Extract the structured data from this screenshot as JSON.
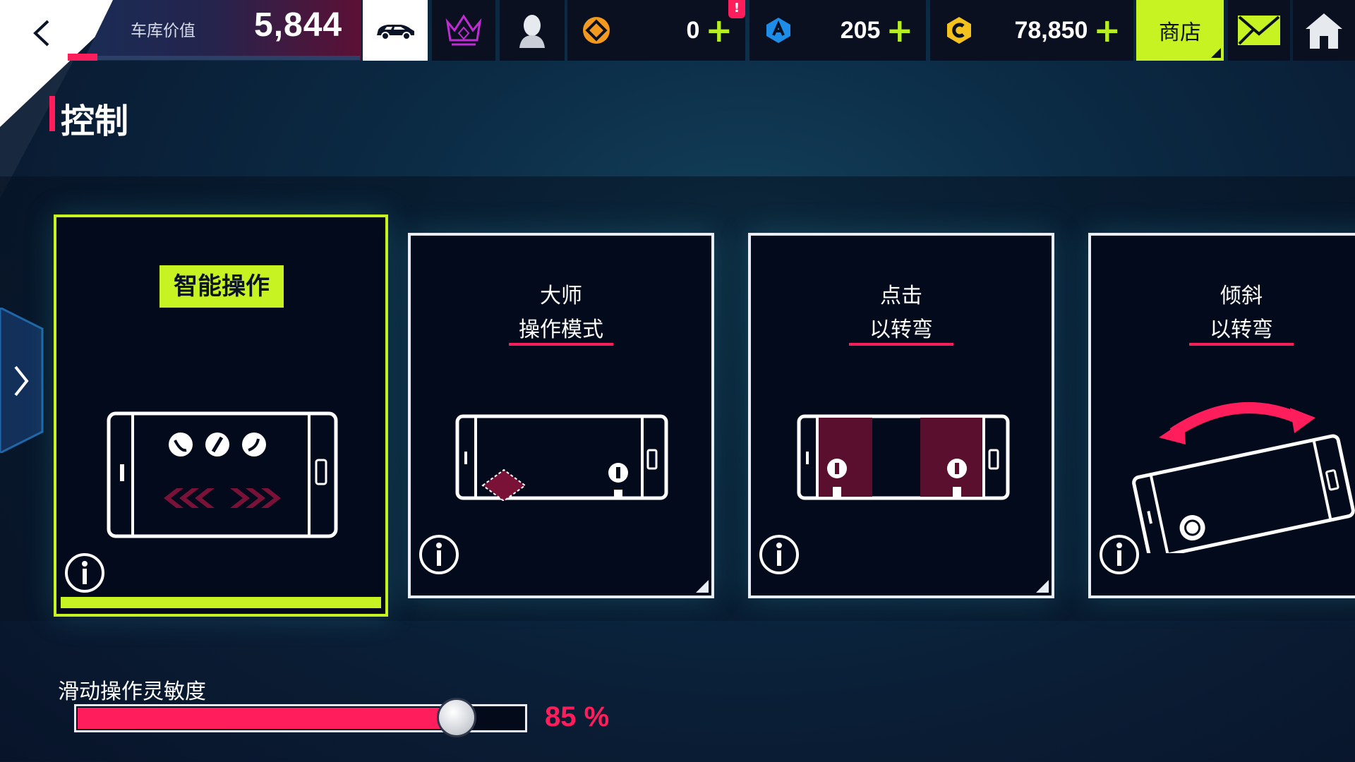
{
  "header": {
    "garage_value_label": "车库价值",
    "garage_value": "5,844",
    "currencies": [
      {
        "name": "pass-token",
        "value": "0",
        "plus": "+",
        "alert": "!"
      },
      {
        "name": "blueprint-token",
        "value": "205",
        "plus": "+"
      },
      {
        "name": "credits",
        "value": "78,850",
        "plus": "+"
      }
    ],
    "shop_label": "商店"
  },
  "page": {
    "title": "控制"
  },
  "cards": [
    {
      "id": "smart",
      "title": "智能操作",
      "selected": true
    },
    {
      "id": "master",
      "title_lines": [
        "大师",
        "操作模式"
      ],
      "selected": false
    },
    {
      "id": "tap",
      "title_lines": [
        "点击",
        "以转弯"
      ],
      "selected": false
    },
    {
      "id": "tilt",
      "title_lines": [
        "倾斜",
        "以转弯"
      ],
      "selected": false
    }
  ],
  "slider": {
    "label": "滑动操作灵敏度",
    "value": 85,
    "value_text": "85 %"
  },
  "icons": {
    "back": "chevron-left-icon",
    "car": "car-icon",
    "crown": "crown-icon",
    "profile": "profile-icon",
    "mail": "mail-icon",
    "home": "home-icon",
    "info": "info-icon",
    "nav": "chevron-right-icon"
  },
  "colors": {
    "accent_lime": "#c6f321",
    "accent_pink": "#ff1d5c",
    "card_bg": "#020a1c"
  }
}
